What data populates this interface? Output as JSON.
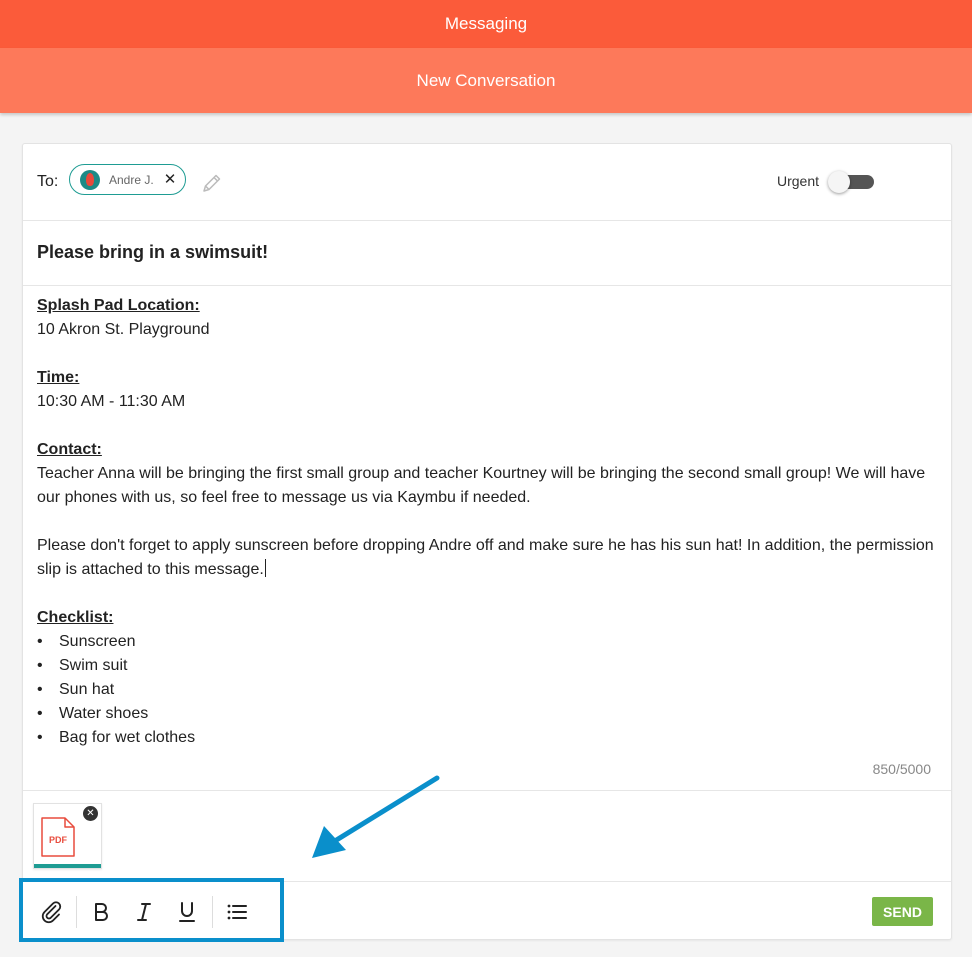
{
  "app": {
    "title": "Messaging",
    "subtitle": "New Conversation"
  },
  "recipients": {
    "to_label": "To:",
    "chips": [
      {
        "name": "Andre J.",
        "avatar": "avatar"
      }
    ],
    "edit_icon": "pencil-icon"
  },
  "urgent": {
    "label": "Urgent",
    "on": false
  },
  "subject": "Please bring in a swimsuit!",
  "body": {
    "location_heading": "Splash Pad Location: ",
    "location_value": "10 Akron St. Playground",
    "time_heading": "Time: ",
    "time_value": "10:30 AM - 11:30 AM",
    "contact_heading": "Contact: ",
    "contact_line1": "Teacher Anna will be bringing the first small group and teacher Kourtney will be bringing the second small group! We will have",
    "contact_line2": "our phones with us, so feel free to message us via Kaymbu if needed.",
    "reminder_line1": "Please don't forget to apply sunscreen before dropping Andre off and make sure he has his sun hat! In addition, the permission",
    "reminder_line2": "slip is attached to this message.",
    "checklist_heading": "Checklist: ",
    "checklist": [
      "Sunscreen",
      "Swim suit",
      "Sun hat",
      "Water shoes",
      "Bag for wet clothes"
    ]
  },
  "counter": "850/5000",
  "attachments": [
    {
      "type_label": "PDF",
      "icon": "pdf-file-icon"
    }
  ],
  "toolbar": {
    "tools": [
      "paperclip-icon",
      "bold-icon",
      "italic-icon",
      "underline-icon",
      "bullet-list-icon"
    ],
    "send_label": "SEND"
  },
  "colors": {
    "header": "#fb5b3a",
    "subheader": "#fd795a",
    "accent": "#1e9c93",
    "send": "#7ab648",
    "highlight": "#0a8fcb"
  }
}
